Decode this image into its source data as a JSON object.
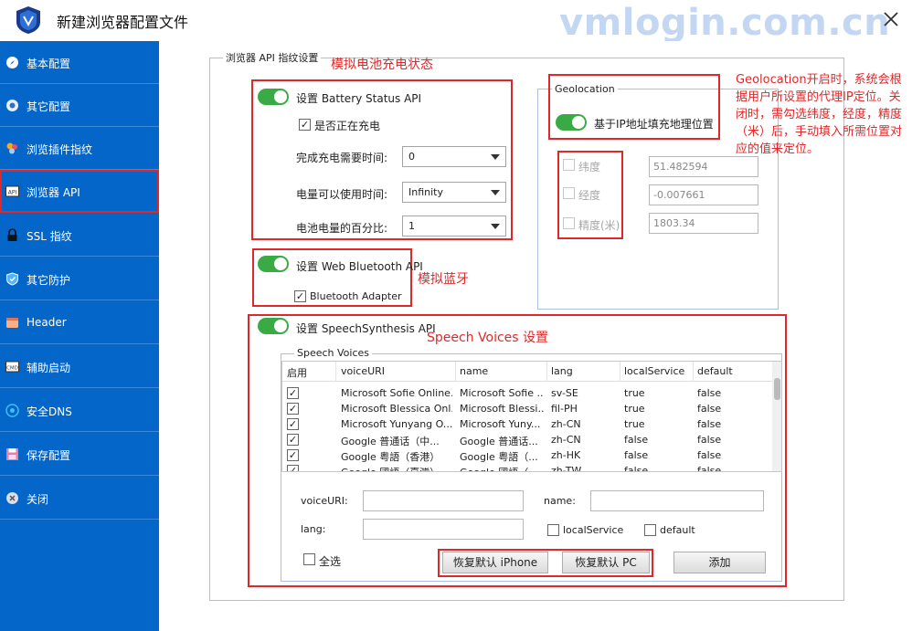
{
  "window": {
    "title": "新建浏览器配置文件",
    "watermark": "vmlogin.com.cn"
  },
  "sidebar": {
    "items": [
      {
        "label": "基本配置",
        "icon": "compass-icon"
      },
      {
        "label": "其它配置",
        "icon": "browser-icon"
      },
      {
        "label": "浏览插件指纹",
        "icon": "plugin-icon"
      },
      {
        "label": "浏览器 API",
        "icon": "api-icon"
      },
      {
        "label": "SSL 指纹",
        "icon": "lock-icon"
      },
      {
        "label": "其它防护",
        "icon": "shield-icon"
      },
      {
        "label": "Header",
        "icon": "header-icon"
      },
      {
        "label": "辅助启动",
        "icon": "cmd-icon"
      },
      {
        "label": "安全DNS",
        "icon": "dns-icon"
      },
      {
        "label": "保存配置",
        "icon": "save-icon"
      },
      {
        "label": "关闭",
        "icon": "close-circle-icon"
      }
    ],
    "active_index": 3
  },
  "main": {
    "group_title": "浏览器 API 指纹设置",
    "battery": {
      "annotation": "模拟电池充电状态",
      "toggle_label": "设置 Battery Status API",
      "charging_label": "是否正在充电",
      "charging_checked": true,
      "charge_time_label": "完成充电需要时间:",
      "charge_time_value": "0",
      "discharge_time_label": "电量可以使用时间:",
      "discharge_time_value": "Infinity",
      "level_label": "电池电量的百分比:",
      "level_value": "1"
    },
    "bluetooth": {
      "annotation": "模拟蓝牙",
      "toggle_label": "设置 Web Bluetooth API",
      "adapter_label": "Bluetooth Adapter",
      "adapter_checked": true
    },
    "geolocation": {
      "group_title": "Geolocation",
      "toggle_label": "基于IP地址填充地理位置",
      "latitude_label": "纬度",
      "latitude_value": "51.482594",
      "longitude_label": "经度",
      "longitude_value": "-0.007661",
      "accuracy_label": "精度(米)",
      "accuracy_value": "1803.34",
      "annotation": "Geolocation开启时，系统会根据用户所设置的代理IP定位。关闭时，需勾选纬度，经度，精度（米）后，手动填入所需位置对应的值来定位。"
    },
    "speech": {
      "toggle_label": "设置 SpeechSynthesis API",
      "annotation": "Speech Voices 设置",
      "voices_title": "Speech Voices",
      "columns": [
        "启用",
        "voiceURI",
        "name",
        "lang",
        "localService",
        "default"
      ],
      "rows": [
        {
          "enabled": true,
          "voiceURI": "Microsoft Sofie Online...",
          "name": "Microsoft Sofie ...",
          "lang": "sv-SE",
          "localService": "true",
          "default": "false"
        },
        {
          "enabled": true,
          "voiceURI": "Microsoft Blessica Onl...",
          "name": "Microsoft Blessi...",
          "lang": "fil-PH",
          "localService": "true",
          "default": "false"
        },
        {
          "enabled": true,
          "voiceURI": "Microsoft Yunyang O...",
          "name": "Microsoft Yuny...",
          "lang": "zh-CN",
          "localService": "true",
          "default": "false"
        },
        {
          "enabled": true,
          "voiceURI": "Google 普通话（中...",
          "name": "Google 普通话...",
          "lang": "zh-CN",
          "localService": "false",
          "default": "false"
        },
        {
          "enabled": true,
          "voiceURI": "Google 粤語（香港）",
          "name": "Google 粤語（...",
          "lang": "zh-HK",
          "localService": "false",
          "default": "false"
        },
        {
          "enabled": true,
          "voiceURI": "Google 國語（臺灣）",
          "name": "Google 國語（...",
          "lang": "zh-TW",
          "localService": "false",
          "default": "false"
        }
      ],
      "voiceuri_label": "voiceURI:",
      "name_label": "name:",
      "lang_label": "lang:",
      "local_service_label": "localService",
      "default_label": "default",
      "select_all_label": "全选",
      "restore_iphone_label": "恢复默认 iPhone",
      "restore_pc_label": "恢复默认 PC",
      "add_label": "添加"
    }
  },
  "colors": {
    "sidebar": "#0466c8",
    "toggle_on": "#3aaa44",
    "annotation": "#e0282a"
  }
}
